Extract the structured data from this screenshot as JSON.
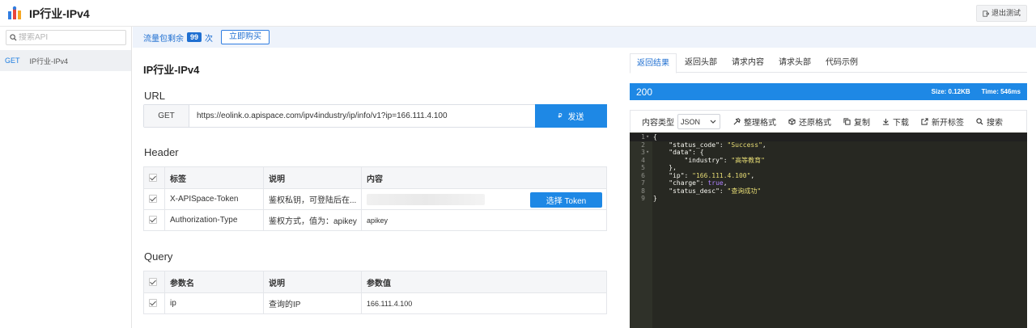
{
  "app": {
    "title": "IP行业-IPv4",
    "exit_label": "退出测试"
  },
  "sidebar": {
    "search_placeholder": "搜索API",
    "items": [
      {
        "method": "GET",
        "name": "IP行业-IPv4"
      }
    ]
  },
  "quota": {
    "prefix": "流量包剩余",
    "count": "99",
    "suffix": "次",
    "buy_label": "立即购买"
  },
  "main": {
    "api_title": "IP行业-IPv4",
    "url_section": "URL",
    "method": "GET",
    "url": "https://eolink.o.apispace.com/ipv4industry/ip/info/v1?ip=166.111.4.100",
    "send_label": "发送",
    "header_section": "Header",
    "header_table": {
      "columns": [
        "标签",
        "说明",
        "内容"
      ],
      "rows": [
        {
          "key": "X-APISpace-Token",
          "desc": "鉴权私钥，可登陆后在...",
          "value": "",
          "button": "选择 Token"
        },
        {
          "key": "Authorization-Type",
          "desc": "鉴权方式，值为：apikey",
          "value": "apikey"
        }
      ]
    },
    "query_section": "Query",
    "query_table": {
      "columns": [
        "参数名",
        "说明",
        "参数值"
      ],
      "rows": [
        {
          "key": "ip",
          "desc": "查询的IP",
          "value": "166.111.4.100"
        }
      ]
    }
  },
  "response": {
    "tabs": [
      "返回结果",
      "返回头部",
      "请求内容",
      "请求头部",
      "代码示例"
    ],
    "active_tab": 0,
    "status": "200",
    "size": "Size:  0.12KB",
    "time": "Time:  546ms",
    "content_type_label": "内容类型",
    "content_type": "JSON",
    "tools": [
      "整理格式",
      "还原格式",
      "复制",
      "下载",
      "新开标签",
      "搜索"
    ],
    "code_lines": [
      {
        "n": "1",
        "fold": true,
        "text": "{"
      },
      {
        "n": "2",
        "text": "    \"status_code\": \"Success\","
      },
      {
        "n": "3",
        "fold": true,
        "text": "    \"data\": {"
      },
      {
        "n": "4",
        "text": "        \"industry\": \"高等教育\""
      },
      {
        "n": "5",
        "text": "    },"
      },
      {
        "n": "6",
        "text": "    \"ip\": \"166.111.4.100\","
      },
      {
        "n": "7",
        "text": "    \"charge\": true,"
      },
      {
        "n": "8",
        "text": "    \"status_desc\": \"查询成功\""
      },
      {
        "n": "9",
        "text": "}"
      }
    ]
  },
  "colors": {
    "primary": "#1e88e5",
    "editor_bg": "#272822"
  }
}
